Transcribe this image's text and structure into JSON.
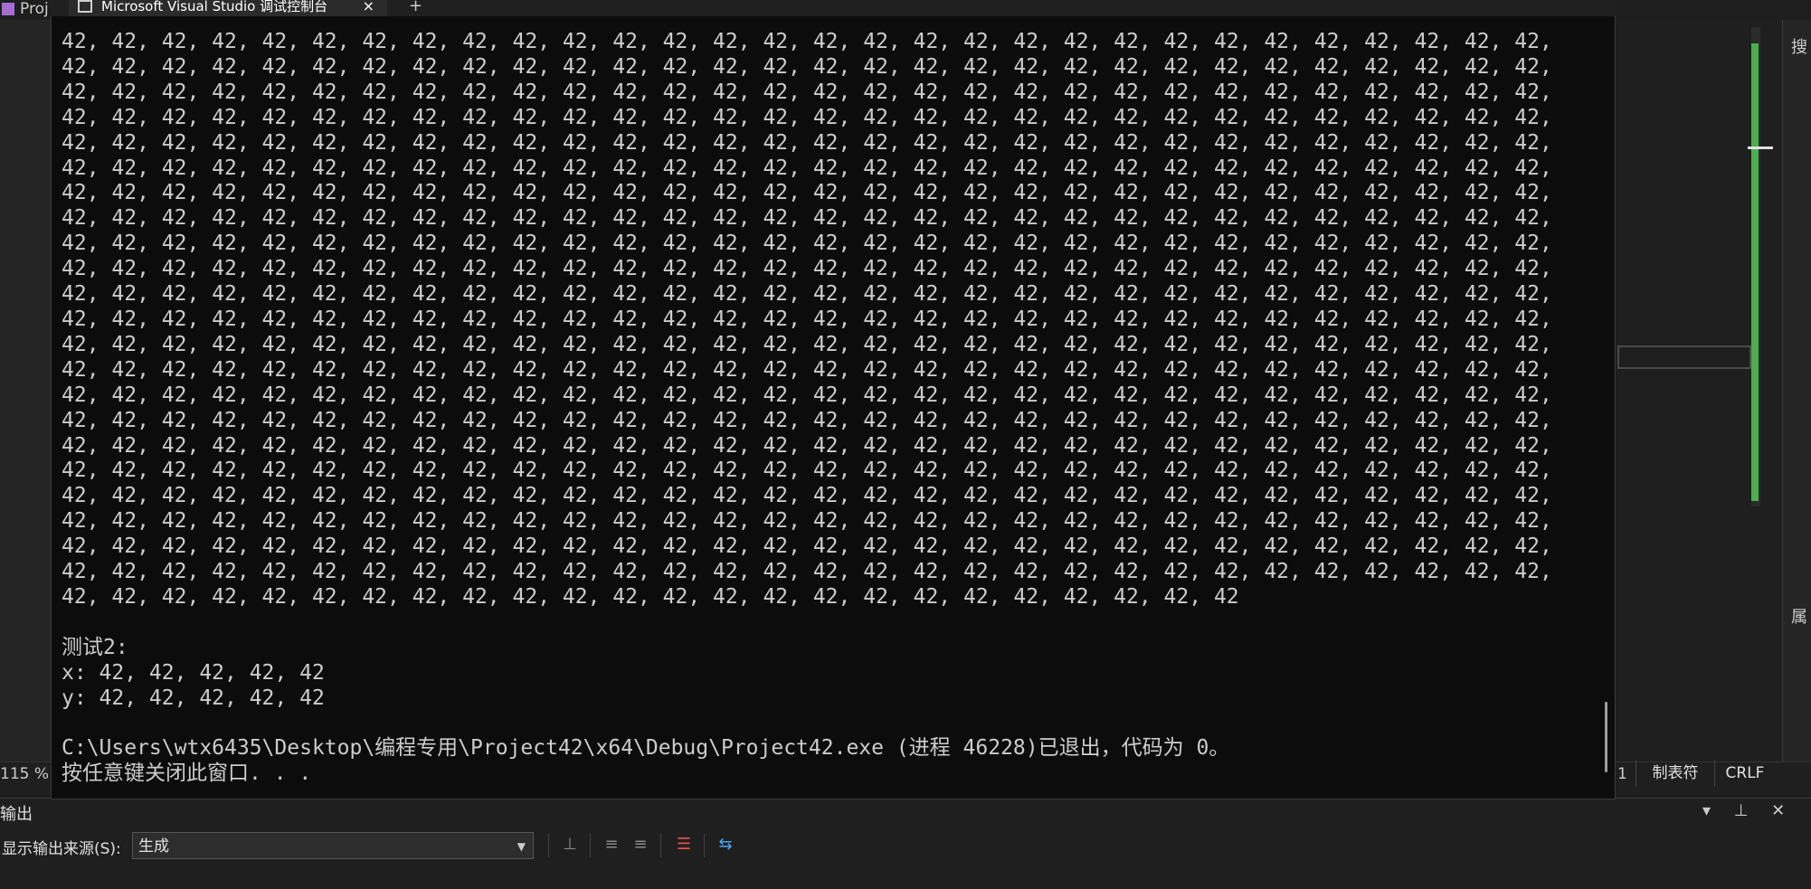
{
  "ide": {
    "project_tab": "Proj",
    "zoom": "115 %",
    "status_num": "1",
    "status_tabs": "制表符",
    "status_crlf": "CRLF",
    "right_search_label": "搜",
    "right_props_label": "属",
    "output_title": "输出",
    "output_source_label": "显示输出来源(S):",
    "output_source_value": "生成",
    "output_controls": "▾ ⊥ ✕"
  },
  "console": {
    "tab_title": "Microsoft Visual Studio 调试控制台",
    "tab_close": "×",
    "new_tab": "+",
    "output_value": "42",
    "full_rows": 22,
    "values_per_row": 30,
    "last_row_count": 24,
    "test2_header": "测试2:",
    "x_line": "x: 42, 42, 42, 42, 42",
    "y_line": "y: 42, 42, 42, 42, 42",
    "exit_line": "C:\\Users\\wtx6435\\Desktop\\编程专用\\Project42\\x64\\Debug\\Project42.exe (进程 46228)已退出，代码为 0。",
    "press_key_line": "按任意键关闭此窗口. . ."
  }
}
